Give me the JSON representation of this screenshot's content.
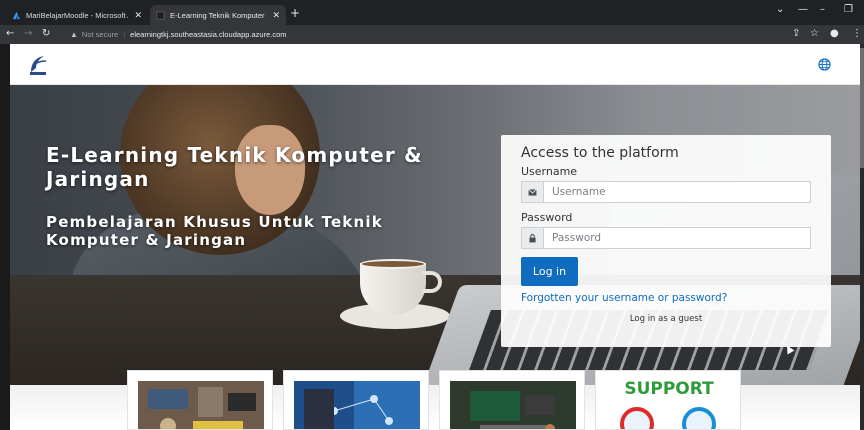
{
  "browser": {
    "tabs": [
      {
        "label": "MariBelajarMoodle - Microsoft A",
        "active": false
      },
      {
        "label": "E-Learning Teknik Komputer & Ja",
        "active": true
      }
    ],
    "address": {
      "not_secure": "Not secure",
      "url": "elearningtkj.southeastasia.cloudapp.azure.com"
    }
  },
  "hero": {
    "title": "E-Learning Teknik Komputer & Jaringan",
    "subtitle": "Pembelajaran Khusus Untuk Teknik Komputer & Jaringan"
  },
  "login": {
    "heading": "Access to the platform",
    "username_label": "Username",
    "username_placeholder": "Username",
    "password_label": "Password",
    "password_placeholder": "Password",
    "login_button": "Log in",
    "forgot_link": "Forgotten your username or password?",
    "guest_link": "Log in as a guest"
  },
  "cards": {
    "support_text": "SUPPORT"
  },
  "colors": {
    "primary": "#0f6cbf",
    "support_green": "#2e9a3a"
  },
  "icons": [
    "logo-icon",
    "globe-icon",
    "envelope-icon",
    "lock-icon"
  ]
}
